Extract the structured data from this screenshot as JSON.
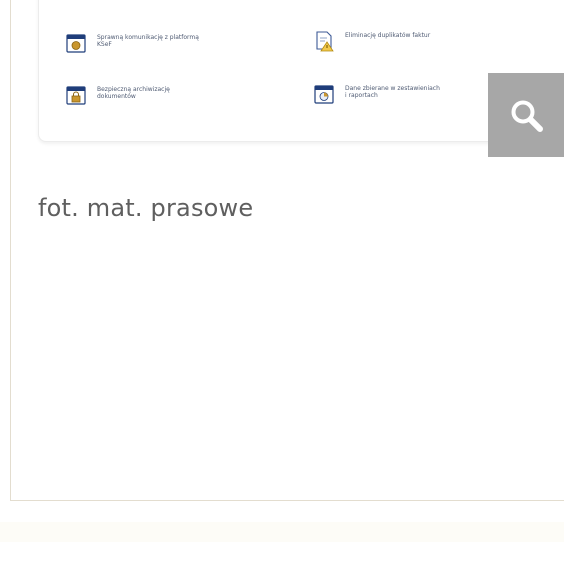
{
  "image": {
    "features": [
      {
        "label": "Sprawną komunikację z platformą\nKSeF",
        "icon": "document-coin-icon"
      },
      {
        "label": "Eliminację duplikatów faktur",
        "icon": "document-warning-icon"
      },
      {
        "label": "Bezpieczną archiwizację\ndokumentów",
        "icon": "document-lock-icon"
      },
      {
        "label": "Dane zbierane w zestawieniach\ni raportach",
        "icon": "document-chart-icon"
      }
    ]
  },
  "zoom": {
    "icon": "magnifier-icon"
  },
  "caption": {
    "text": "fot. mat. prasowe"
  },
  "colors": {
    "zoom_bg": "#a7a7a7",
    "caption": "#5f5f5f",
    "feature_text": "#4e5a72",
    "card_border": "#e3ddcf"
  }
}
